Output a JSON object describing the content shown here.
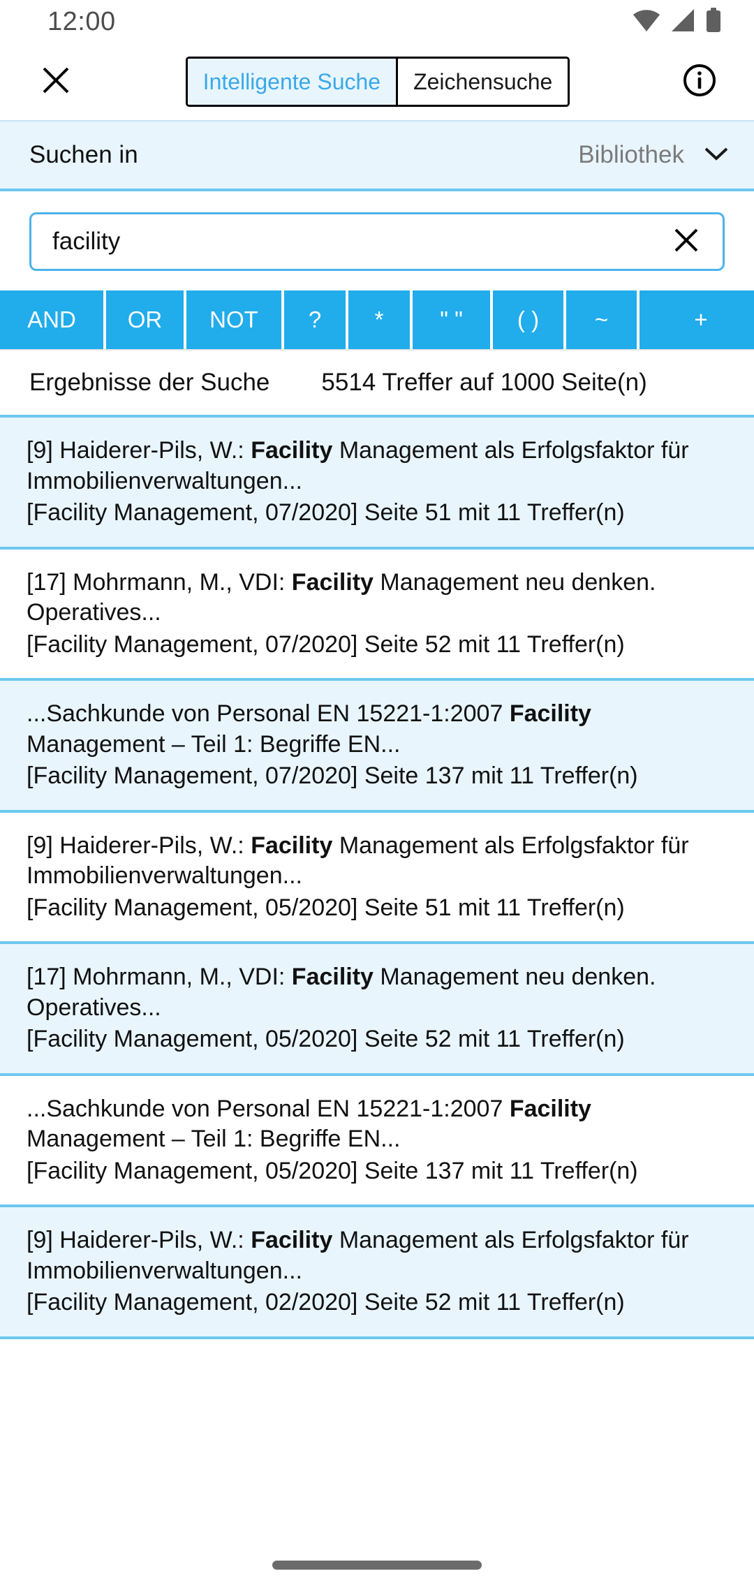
{
  "status_bar": {
    "time": "12:00",
    "icons": [
      "wifi-icon",
      "cell-signal-icon",
      "battery-icon"
    ]
  },
  "appbar": {
    "close_icon": "close-icon",
    "info_icon": "info-icon",
    "tabs": [
      {
        "label": "Intelligente Suche",
        "active": true
      },
      {
        "label": "Zeichensuche",
        "active": false
      }
    ]
  },
  "scope": {
    "label": "Suchen in",
    "value": "Bibliothek",
    "chevron_icon": "chevron-down-icon"
  },
  "search": {
    "value": "facility",
    "placeholder": "",
    "clear_icon": "close-icon"
  },
  "operators": [
    "AND",
    "OR",
    "NOT",
    "?",
    "*",
    "\" \"",
    "( )",
    "~",
    "+"
  ],
  "results_header": {
    "label": "Ergebnisse der Suche",
    "count": "5514 Treffer auf 1000 Seite(n)"
  },
  "results": [
    {
      "prefix": "[9] Haiderer-Pils, W.: ",
      "highlight": "Facility",
      "suffix": " Management als Erfolgsfaktor für Immobilienverwaltungen...",
      "meta": "[Facility Management, 07/2020] Seite 51 mit 11 Treffer(n)"
    },
    {
      "prefix": "[17] Mohrmann, M., VDI: ",
      "highlight": "Facility",
      "suffix": " Management neu denken. Operatives...",
      "meta": "[Facility Management, 07/2020] Seite 52 mit 11 Treffer(n)"
    },
    {
      "prefix": "...Sachkunde von Personal EN 15221-1:2007 ",
      "highlight": "Facility",
      "suffix": " Management – Teil 1: Begriffe EN...",
      "meta": "[Facility Management, 07/2020] Seite 137 mit 11 Treffer(n)"
    },
    {
      "prefix": "[9] Haiderer-Pils, W.: ",
      "highlight": "Facility",
      "suffix": " Management als Erfolgsfaktor für Immobilienverwaltungen...",
      "meta": "[Facility Management, 05/2020] Seite 51 mit 11 Treffer(n)"
    },
    {
      "prefix": "[17] Mohrmann, M., VDI: ",
      "highlight": "Facility",
      "suffix": " Management neu denken. Operatives...",
      "meta": "[Facility Management, 05/2020] Seite 52 mit 11 Treffer(n)"
    },
    {
      "prefix": "...Sachkunde von Personal EN 15221-1:2007 ",
      "highlight": "Facility",
      "suffix": " Management – Teil 1: Begriffe EN...",
      "meta": "[Facility Management, 05/2020] Seite 137 mit 11 Treffer(n)"
    },
    {
      "prefix": "[9] Haiderer-Pils, W.: ",
      "highlight": "Facility",
      "suffix": " Management als Erfolgsfaktor für Immobilienverwaltungen...",
      "meta": "[Facility Management, 02/2020] Seite 52 mit 11 Treffer(n)"
    }
  ],
  "colors": {
    "accent": "#21aceb",
    "tab_active_text": "#3aa9e8",
    "row_alt_bg": "#e8f5fd",
    "divider": "#6dc8ef",
    "field_border": "#4cb3ea"
  }
}
